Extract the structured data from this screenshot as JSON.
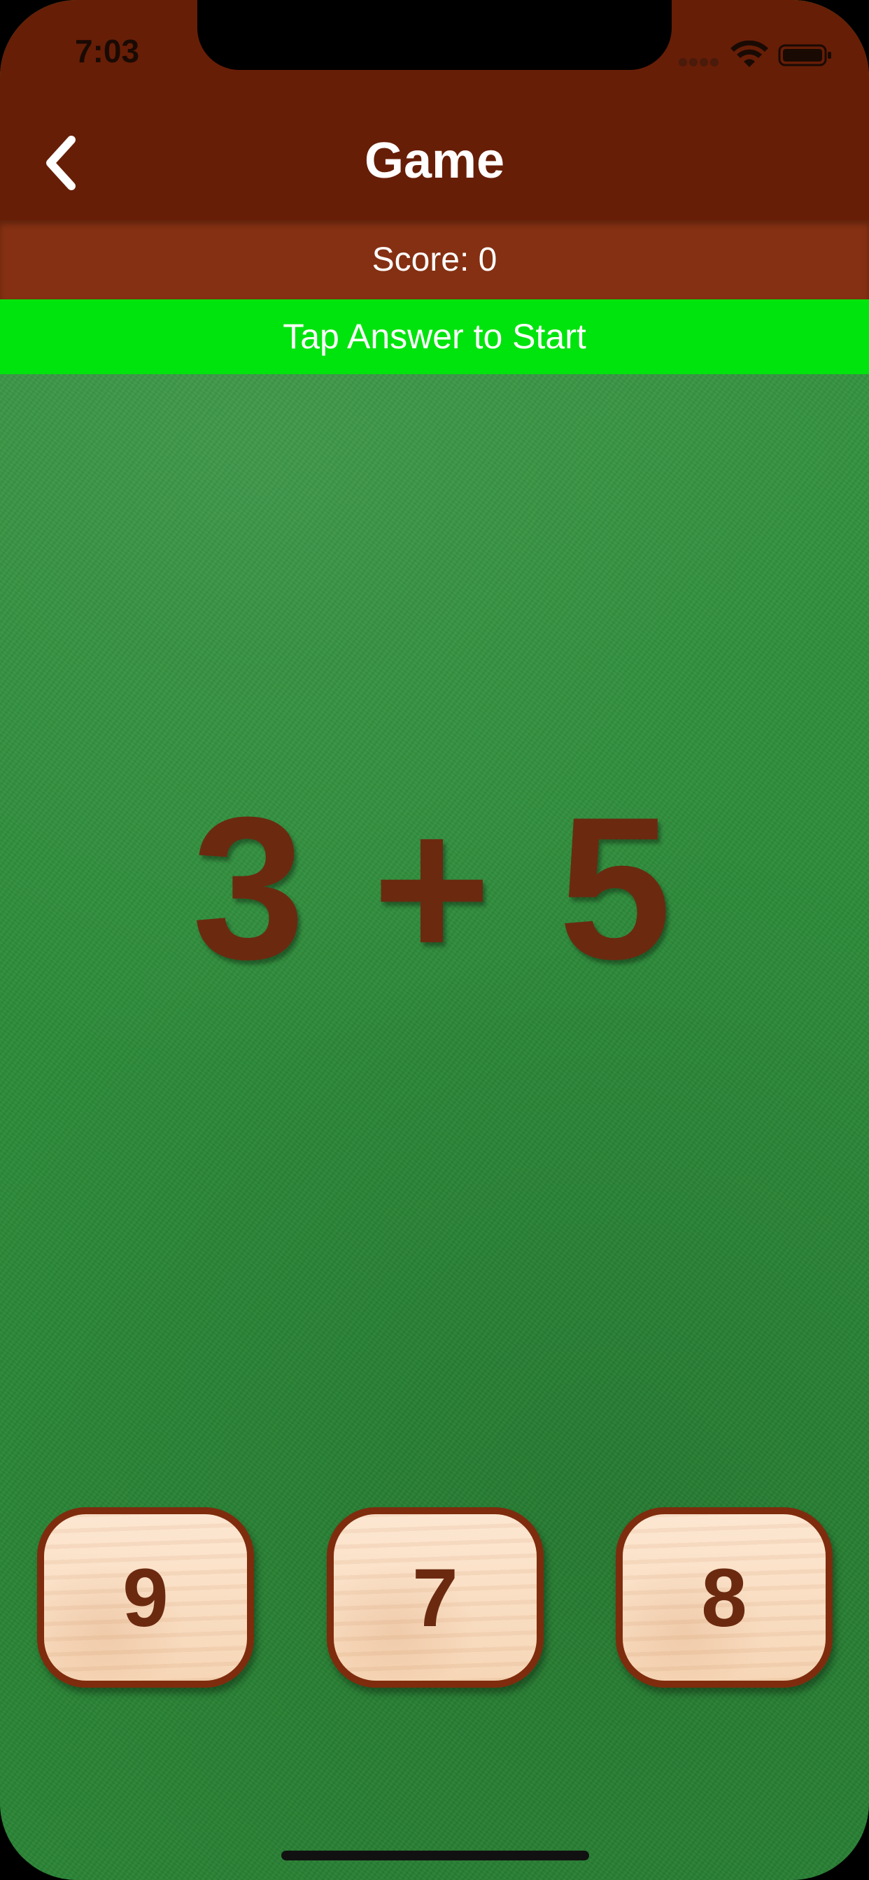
{
  "status_bar": {
    "time": "7:03",
    "wifi_icon": "wifi-icon",
    "battery_icon": "battery-icon"
  },
  "nav": {
    "title": "Game",
    "back_icon": "chevron-left-icon"
  },
  "score": {
    "label": "Score: 0"
  },
  "banner": {
    "text": "Tap Answer to Start",
    "color": "#00e40d"
  },
  "question": {
    "text": "3 + 5"
  },
  "answers": [
    {
      "label": "9"
    },
    {
      "label": "7"
    },
    {
      "label": "8"
    }
  ],
  "colors": {
    "header": "#671e06",
    "score_bar": "#853012",
    "felt": "#2f8f3c",
    "text_brown": "#6b2a10"
  }
}
